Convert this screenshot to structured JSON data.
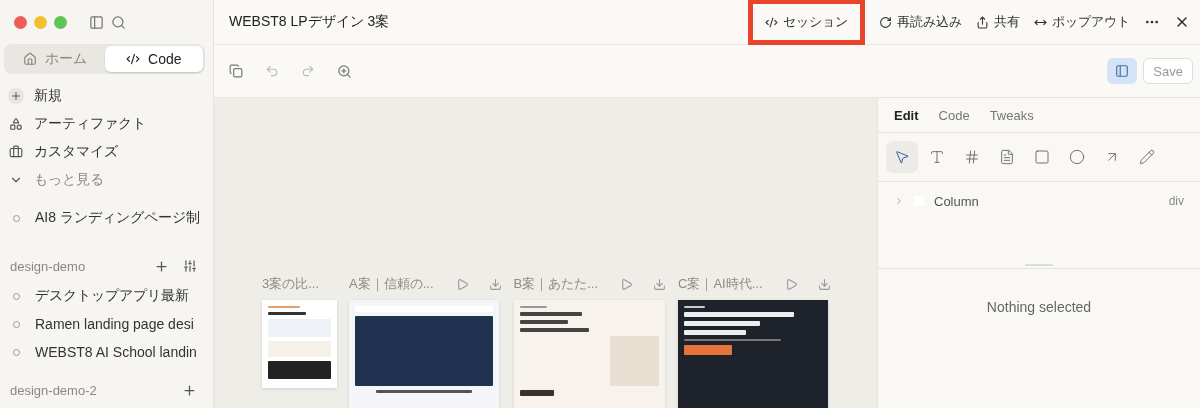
{
  "sidebar": {
    "mode_tabs": [
      {
        "label": "ホーム",
        "selected": false
      },
      {
        "label": "Code",
        "selected": true
      }
    ],
    "nav": [
      {
        "label": "新規",
        "muted": false
      },
      {
        "label": "アーティファクト",
        "muted": false
      },
      {
        "label": "カスタマイズ",
        "muted": false
      },
      {
        "label": "もっと見る",
        "muted": true
      }
    ],
    "recents": [
      {
        "label": "AI8 ランディングページ制"
      }
    ],
    "projects": [
      {
        "name": "design-demo",
        "items": [
          {
            "label": "デスクトップアプリ最新"
          },
          {
            "label": "Ramen landing page desi"
          },
          {
            "label": "WEBST8 AI School landin"
          }
        ]
      },
      {
        "name": "design-demo-2"
      }
    ]
  },
  "header": {
    "title": "WEBST8 LPデザイン 3案",
    "actions": [
      {
        "label": "セッション",
        "highlighted": true
      },
      {
        "label": "再読み込み",
        "highlighted": false
      },
      {
        "label": "共有",
        "highlighted": false
      },
      {
        "label": "ポップアウト",
        "highlighted": false
      }
    ]
  },
  "toolbar": {
    "panel_toggle": {
      "selected": true
    },
    "save": {
      "label": "Save",
      "disabled": true
    }
  },
  "canvas": {
    "cards": [
      {
        "title": "3案の比...",
        "kind": "summary",
        "actions": false
      },
      {
        "title": "A案｜信頼の...",
        "kind": "navy",
        "actions": true
      },
      {
        "title": "B案｜あたた...",
        "kind": "cream",
        "actions": true
      },
      {
        "title": "C案｜AI時代...",
        "kind": "dark",
        "actions": true
      }
    ]
  },
  "inspector": {
    "tabs": [
      {
        "label": "Edit",
        "selected": true
      },
      {
        "label": "Code",
        "selected": false
      },
      {
        "label": "Tweaks",
        "selected": false
      }
    ],
    "tools": [
      {
        "selected": true
      },
      {
        "selected": false
      },
      {
        "selected": false
      },
      {
        "selected": false
      },
      {
        "selected": false
      },
      {
        "selected": false
      },
      {
        "selected": false
      },
      {
        "selected": false
      }
    ],
    "layers": [
      {
        "label": "Column",
        "tag": "div",
        "expanded": false
      }
    ],
    "empty_state": "Nothing selected"
  }
}
